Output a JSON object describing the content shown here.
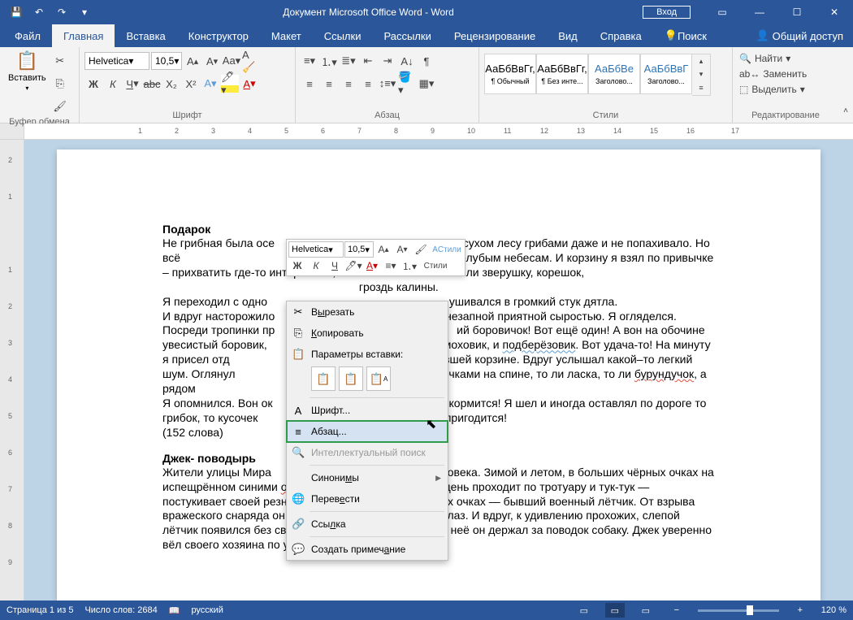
{
  "titlebar": {
    "title": "Документ Microsoft Office Word  -  Word",
    "login": "Вход"
  },
  "menu": {
    "file": "Файл",
    "home": "Главная",
    "insert": "Вставка",
    "design": "Конструктор",
    "layout": "Макет",
    "refs": "Ссылки",
    "mail": "Рассылки",
    "review": "Рецензирование",
    "view": "Вид",
    "help": "Справка",
    "search": "Поиск",
    "share": "Общий доступ"
  },
  "ribbon": {
    "clipboard": {
      "paste": "Вставить",
      "label": "Буфер обмена"
    },
    "font": {
      "name": "Helvetica",
      "size": "10,5",
      "label": "Шрифт"
    },
    "para": {
      "label": "Абзац"
    },
    "styles": {
      "label": "Стили",
      "items": [
        {
          "preview": "АаБбВвГг,",
          "name": "¶ Обычный"
        },
        {
          "preview": "АаБбВвГг,",
          "name": "¶ Без инте..."
        },
        {
          "preview": "АаБбВе",
          "name": "Заголово..."
        },
        {
          "preview": "АаБбВвГ",
          "name": "Заголово..."
        }
      ]
    },
    "editing": {
      "find": "Найти",
      "replace": "Заменить",
      "select": "Выделить",
      "label": "Редактирование"
    }
  },
  "mini": {
    "font": "Helvetica",
    "size": "10,5",
    "styles": "Стили"
  },
  "ctx": {
    "cut": "Вырезать",
    "copy": "Копировать",
    "paste_label": "Параметры вставки:",
    "font": "Шрифт...",
    "para": "Абзац...",
    "smart": "Интеллектуальный поиск",
    "syn": "Синонимы",
    "trans": "Перевести",
    "link": "Ссылка",
    "comment": "Создать примечание"
  },
  "doc": {
    "h1": "Подарок",
    "p1a": "Не грибная была осе",
    "p1b": "ном сухом лесу грибами даже и не попахивало. Но всё",
    "p1c": "шкам, к просторным голубым небесам. И корзину я взял по привычке – прихватить где-то интересный, похожий на человечка или зверушку, корешок, ",
    "p1d": " гроздь калины.",
    "p2a": "Я переходил с одно",
    "p2b": "ушивался в громкий стук дятла.",
    "p3a": "И вдруг насторожило",
    "p3b": "незапной приятной сыростью. Я огляделся. Посреди тропинки пр",
    "p3c": "ий боровичок! Вот ещё один! А вон на обочине увесистый боровик,",
    "p3d": "моховик, и ",
    "p3e": "подберёзовик",
    "p3f": ". Вот удача-то! На минуту я присел отд",
    "p3g": "тяжелевшей корзине. Вдруг услышал какой–то легкий шум. Оглянул",
    "p3h": "полосочками на спине, то ли ласка, то ли ",
    "p3i": "бурундучок",
    "p3j": ", а рядом",
    "p4a": "Я опомнился. Вон ок",
    "p4b": "кормится! Я шел и иногда оставлял по дороге то грибок, то кусочек",
    "p4c": "м пригодится!",
    "p5": "(152 слова)",
    "h2": "Джек- поводырь",
    "p6a": "Жители улицы Мира",
    "p6b": "овека. Зимой и летом, в больших чёрных очках на испещрённом синими ",
    "p6c": "отметинками",
    "p6d": " лице, он каждый день проходит по тротуару и тук-тук — постукивает своей резной палочкой. Человек в чёрных очках — бывший военный лётчик. От взрыва вражеского снаряда он лишился одной руки и обоих глаз. И вдруг, к удивлению прохожих, слепой лётчик появился без своей извечной палочки. Вместо неё он держал за поводок собаку. Джек уверенно вёл своего хозяина по улице. У перекрёстка Джек"
  },
  "status": {
    "page": "Страница 1 из 5",
    "words": "Число слов: 2684",
    "lang": "русский",
    "zoom": "120 %"
  }
}
